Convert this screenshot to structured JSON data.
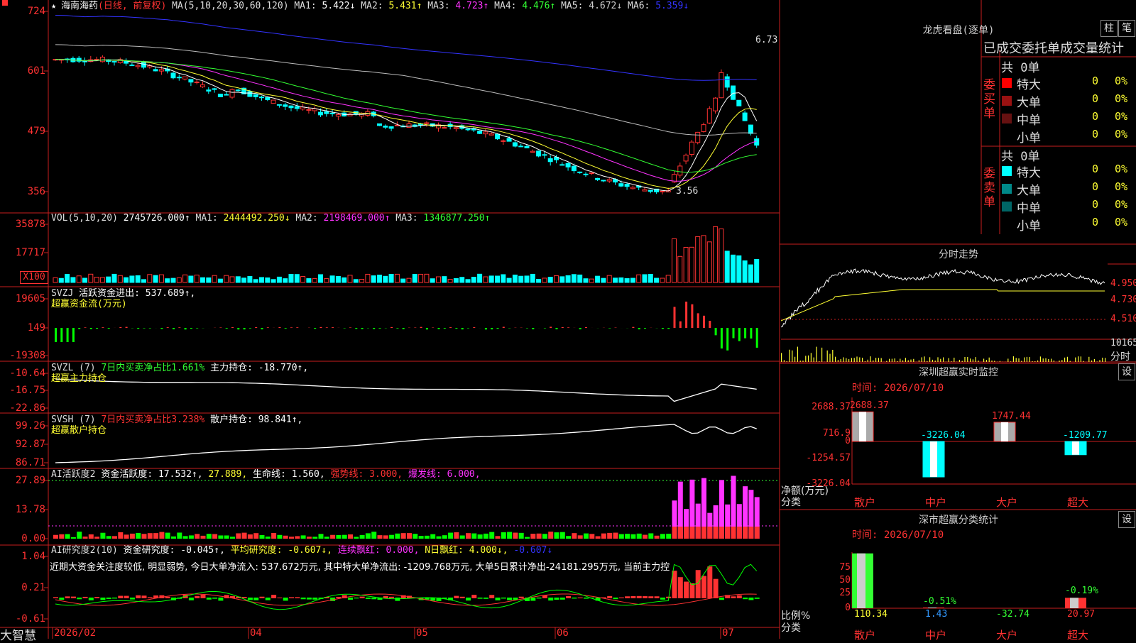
{
  "app": {
    "name": "大智慧"
  },
  "stock": {
    "name": "海南海药",
    "mode": "(日线, 前复权)"
  },
  "main": {
    "ma_label": "MA(5,10,20,30,60,120)",
    "ma": [
      {
        "k": "MA1:",
        "v": "5.422↓",
        "color": "#ffffff"
      },
      {
        "k": "MA2:",
        "v": "5.431↑",
        "color": "#ffff33"
      },
      {
        "k": "MA3:",
        "v": "4.723↑",
        "color": "#ff33ff"
      },
      {
        "k": "MA4:",
        "v": "4.476↑",
        "color": "#33ff33"
      },
      {
        "k": "MA5:",
        "v": "4.672↓",
        "color": "#cccccc"
      },
      {
        "k": "MA6:",
        "v": "5.359↓",
        "color": "#3333ff"
      }
    ],
    "yticks": [
      "724",
      "601",
      "479",
      "356"
    ],
    "high_label": "6.73",
    "low_label": "3.56"
  },
  "vol": {
    "label": "VOL(5,10,20)",
    "value": "2745726.000↑",
    "ma": [
      {
        "k": "MA1:",
        "v": "2444492.250↓",
        "color": "#ffff33"
      },
      {
        "k": "MA2:",
        "v": "2198469.000↑",
        "color": "#ff33ff"
      },
      {
        "k": "MA3:",
        "v": "1346877.250↑",
        "color": "#33ff33"
      }
    ],
    "yticks": [
      "35878",
      "17717"
    ],
    "unit": "X100"
  },
  "svzj": {
    "name": "SVZJ",
    "text": "活跃资金进出: 537.689↑,",
    "sub": "超赢资金流(万元)",
    "yticks": [
      "19605",
      "149",
      "-19308"
    ]
  },
  "svzl": {
    "name": "SVZL (7)",
    "pct": "7日内买卖净占比1.661%",
    "text": "主力持仓: -18.770↑,",
    "sub": "超赢主力持仓",
    "yticks": [
      "-10.64",
      "-16.75",
      "-22.86"
    ]
  },
  "svsh": {
    "name": "SVSH (7)",
    "pct": "7日内买卖净占比3.238%",
    "text": "散户持仓: 98.841↑,",
    "sub": "超赢散户持仓",
    "yticks": [
      "99.26",
      "92.87",
      "86.71"
    ]
  },
  "ai1": {
    "name": "AI活跃度2",
    "t1": "资金活跃度: 17.532↑,",
    "t2": "27.889,",
    "t3": "生命线: 1.560,",
    "t4": "强势线: 3.000,",
    "t5": "爆发线: 6.000,",
    "yticks": [
      "27.89",
      "13.78",
      "0.00"
    ]
  },
  "ai2": {
    "name": "AI研究度2(10)",
    "t1": "资金研究度: -0.045↑,",
    "t2": "平均研究度: -0.607↓,",
    "t3": "连续飘红: 0.000,",
    "t4": "N日飘红: 4.000↓,",
    "t5": "-0.607↓",
    "comment": "近期大资金关注度较低, 明显弱势, 今日大单净流入: 537.672万元, 其中特大单净流出: -1209.768万元, 大单5日累计净出-24181.295万元, 当前主力控",
    "yticks": [
      "1.04",
      "0.21",
      "-0.61"
    ]
  },
  "xaxis": [
    "2026/02",
    "04",
    "05",
    "06",
    "07"
  ],
  "lhb": {
    "title": "龙虎看盘(逐单)",
    "btn1": "柱",
    "btn2": "笔",
    "header": "已成交委托单成交量统计",
    "buy_label": "委买单",
    "sell_label": "委卖单",
    "buy_total": "共 0单",
    "sell_total": "共 0单",
    "rows_buy": [
      {
        "name": "特大",
        "n": "0",
        "p": "0%",
        "color": "#ff0000"
      },
      {
        "name": "大单",
        "n": "0",
        "p": "0%",
        "color": "#991111"
      },
      {
        "name": "中单",
        "n": "0",
        "p": "0%",
        "color": "#661111"
      },
      {
        "name": "小单",
        "n": "0",
        "p": "0%",
        "color": ""
      }
    ],
    "rows_sell": [
      {
        "name": "特大",
        "n": "0",
        "p": "0%",
        "color": "#00ffff"
      },
      {
        "name": "大单",
        "n": "0",
        "p": "0%",
        "color": "#008888"
      },
      {
        "name": "中单",
        "n": "0",
        "p": "0%",
        "color": "#006666"
      },
      {
        "name": "小单",
        "n": "0",
        "p": "0%",
        "color": ""
      }
    ]
  },
  "fenshi": {
    "title": "分时走势",
    "yticks": [
      "4.950",
      "4.730",
      "4.510"
    ],
    "vol_tick": "10165",
    "vol_label": "分时"
  },
  "monitor": {
    "title": "深圳超赢实时监控",
    "btn": "设",
    "time": "时间: 2026/07/10",
    "yticks": [
      "2688.37",
      "716.9",
      "0",
      "-1254.57",
      "-3226.04"
    ],
    "ylabel": "净额(万元)",
    "xlabel": "分类",
    "cats": [
      "散户",
      "中户",
      "大户",
      "超大"
    ],
    "values": [
      2688.37,
      -3226.04,
      1747.44,
      -1209.77
    ],
    "value_labels": [
      "2688.37",
      "-3226.04",
      "1747.44",
      "-1209.77"
    ]
  },
  "stats": {
    "title": "深市超赢分类统计",
    "btn": "设",
    "time": "时间: 2026/07/10",
    "yticks": [
      "75",
      "50",
      "25",
      "0"
    ],
    "ylabel": "比例%",
    "xlabel": "分类",
    "cats": [
      "散户",
      "中户",
      "大户",
      "超大"
    ],
    "values": [
      110.34,
      1.43,
      -32.74,
      20.97
    ],
    "value_labels": [
      "110.34",
      "1.43",
      "-32.74",
      "20.97"
    ],
    "pct_labels": [
      "-0.51%",
      "-0.19%"
    ]
  }
}
